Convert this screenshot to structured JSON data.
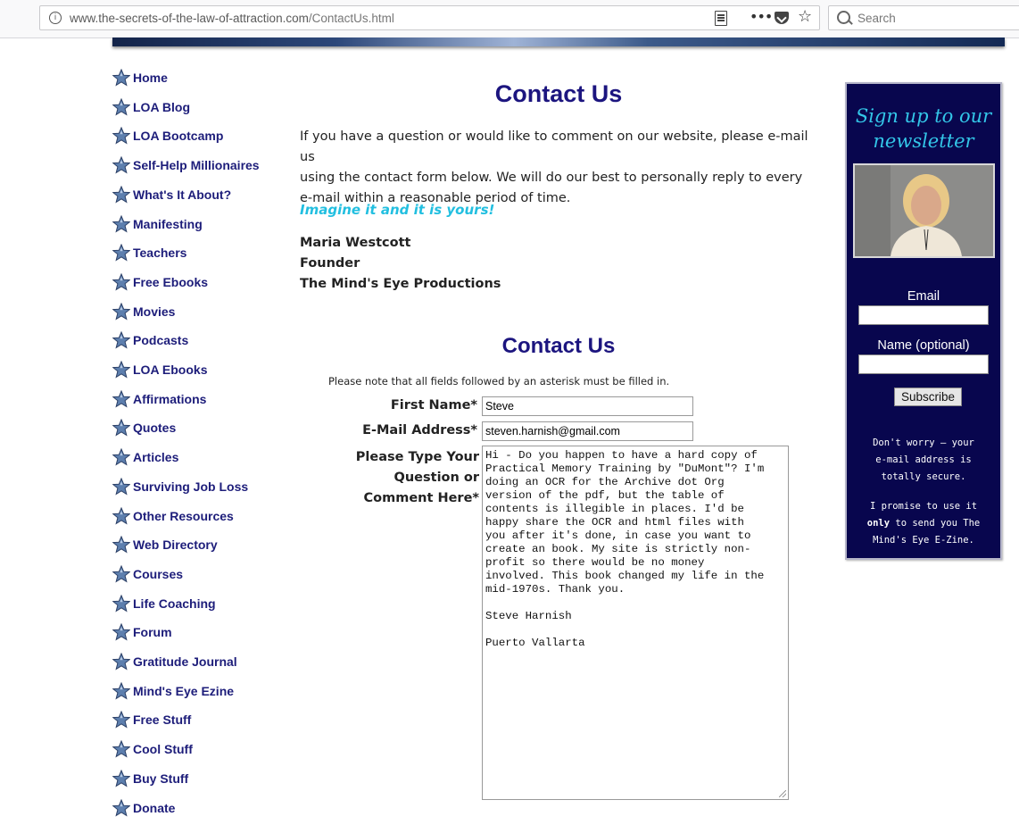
{
  "browser": {
    "url_domain": "www.the-secrets-of-the-law-of-attraction.com",
    "url_path": "/ContactUs.html",
    "search_placeholder": "Search"
  },
  "sidebar": {
    "items": [
      {
        "label": "Home"
      },
      {
        "label": "LOA Blog"
      },
      {
        "label": "LOA Bootcamp"
      },
      {
        "label": "Self-Help Millionaires"
      },
      {
        "label": "What's It About?"
      },
      {
        "label": "Manifesting"
      },
      {
        "label": "Teachers"
      },
      {
        "label": "Free Ebooks"
      },
      {
        "label": "Movies"
      },
      {
        "label": "Podcasts"
      },
      {
        "label": "LOA Ebooks"
      },
      {
        "label": "Affirmations"
      },
      {
        "label": "Quotes"
      },
      {
        "label": "Articles"
      },
      {
        "label": "Surviving Job Loss"
      },
      {
        "label": "Other Resources"
      },
      {
        "label": "Web Directory"
      },
      {
        "label": "Courses"
      },
      {
        "label": "Life Coaching"
      },
      {
        "label": "Forum"
      },
      {
        "label": "Gratitude Journal"
      },
      {
        "label": "Mind's Eye Ezine"
      },
      {
        "label": "Free Stuff"
      },
      {
        "label": "Cool Stuff"
      },
      {
        "label": "Buy Stuff"
      },
      {
        "label": "Donate"
      }
    ]
  },
  "main": {
    "title": "Contact Us",
    "intro_line1": "If you have a question or would like to comment on our website, please e-mail us",
    "intro_line2": "using the contact form below. We will do our best to personally reply to every",
    "intro_line3": "e-mail within a reasonable period of time.",
    "motto": "Imagine it and it is yours!",
    "signature_name": "Maria Westcott",
    "signature_role": "Founder",
    "signature_company": "The Mind's Eye Productions"
  },
  "form": {
    "title": "Contact Us",
    "note": "Please note that all fields followed by an asterisk must be filled in.",
    "first_name_label": "First Name*",
    "first_name_value": "Steve",
    "email_label": "E-Mail Address*",
    "email_value": "steven.harnish@gmail.com",
    "comment_label_line1": "Please Type Your",
    "comment_label_line2": "Question or",
    "comment_label_line3": "Comment Here*",
    "comment_value": "Hi - Do you happen to have a hard copy of\nPractical Memory Training by \"DuMont\"? I'm\ndoing an OCR for the Archive dot Org\nversion of the pdf, but the table of\ncontents is illegible in places. I'd be\nhappy share the OCR and html files with\nyou after it's done, in case you want to\ncreate an book. My site is strictly non-\nprofit so there would be no money\ninvolved. This book changed my life in the\nmid-1970s. Thank you.\n\nSteve Harnish\n\nPuerto Vallarta"
  },
  "newsletter": {
    "title_line1": "Sign up to our",
    "title_line2": "newsletter",
    "email_label": "Email",
    "name_label": "Name (optional)",
    "subscribe_label": "Subscribe",
    "note1_line1": "Don't worry — your",
    "note1_line2": "e-mail address is",
    "note1_line3": "totally secure.",
    "note2_line1": "I promise to use it",
    "note2_line2_bold": "only",
    "note2_line2_rest": " to send you The",
    "note2_line3": "Mind's Eye E-Zine."
  },
  "colors": {
    "nav_text": "#1d1d7a",
    "heading": "#1c157f",
    "motto": "#22bfe0",
    "newsletter_bg": "#08064e",
    "newsletter_title": "#33c6e8"
  }
}
